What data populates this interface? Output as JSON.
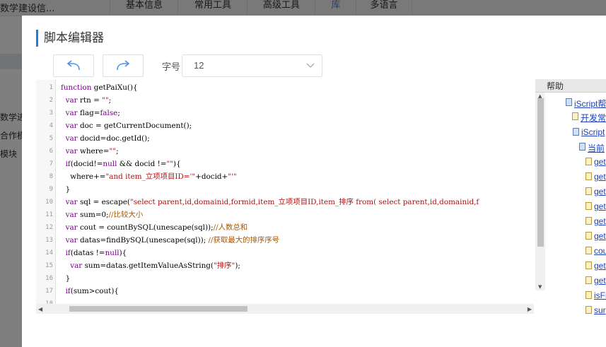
{
  "background": {
    "brand": "数学建设信...",
    "tabs": [
      "基本信息",
      "常用工具",
      "高级工具",
      "库",
      "多语言"
    ],
    "side_items": [
      "数学进",
      "合作模",
      "模块"
    ]
  },
  "dialog": {
    "title": "脚本编辑器",
    "font_size_label": "字号",
    "font_size_value": "12"
  },
  "editor": {
    "line_numbers": [
      "1",
      "2",
      "3",
      "4",
      "5",
      "6",
      "7",
      "8",
      "9",
      "10",
      "11",
      "12",
      "13",
      "14",
      "15",
      "16",
      "17",
      "18"
    ],
    "lines": [
      "function getPaiXu(){",
      "  var rtn = \"\";",
      "  var flag=false;",
      "  var doc = getCurrentDocument();",
      "  var docid=doc.getId();",
      "  var where=\"\";",
      "  if(docid!=null && docid !=\"\"){",
      "    where+=\"and item_立项项目ID='\"+docid+\"'\"",
      "  }",
      "  var sql = escape(\"select parent,id,domainid,formid,item_立项项目ID,item_排序 from( select parent,id,domainid,f",
      "  var sum=0;//比较大小",
      "  var cout = countBySQL(unescape(sql));//人数总和",
      "  var datas=findBySQL(unescape(sql)); //获取最大的排序序号",
      "  if(datas !=null){",
      "    var sum=datas.getItemValueAsString(\"排序\");",
      "  }",
      "  if(sum>cout){",
      ""
    ]
  },
  "help": {
    "title": "帮助",
    "items": [
      "iScript帮",
      "开发常",
      "iScript",
      "当前",
      "get",
      "get",
      "get",
      "get",
      "get",
      "get",
      "cou",
      "get",
      "get",
      "isFi",
      "sur"
    ]
  }
}
